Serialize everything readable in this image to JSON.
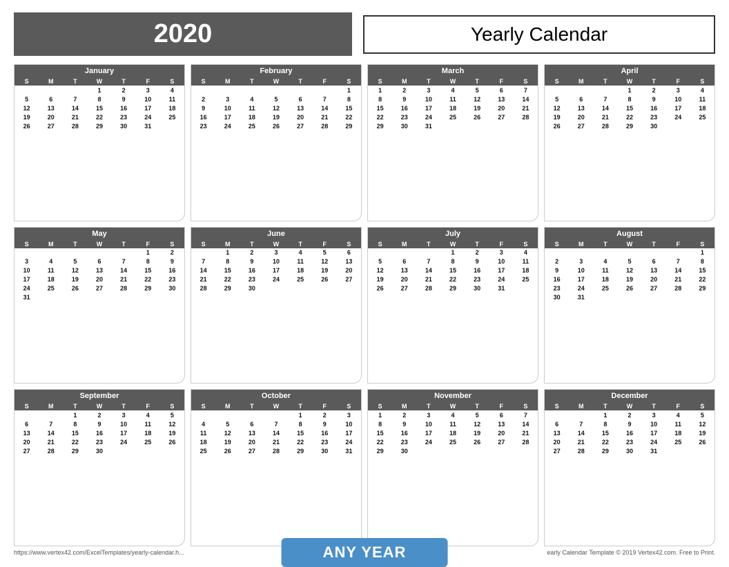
{
  "header": {
    "year": "2020",
    "title": "Yearly Calendar"
  },
  "footer": {
    "left": "https://www.vertex42.com/ExcelTemplates/yearly-calendar.h...",
    "right": "early Calendar Template © 2019 Vertex42.com. Free to Print.",
    "button": "ANY YEAR"
  },
  "months": [
    {
      "name": "January",
      "startDay": 3,
      "days": 31
    },
    {
      "name": "February",
      "startDay": 6,
      "days": 29
    },
    {
      "name": "March",
      "startDay": 0,
      "days": 31
    },
    {
      "name": "April",
      "startDay": 3,
      "days": 30
    },
    {
      "name": "May",
      "startDay": 5,
      "days": 31
    },
    {
      "name": "June",
      "startDay": 1,
      "days": 30
    },
    {
      "name": "July",
      "startDay": 3,
      "days": 31
    },
    {
      "name": "August",
      "startDay": 6,
      "days": 31
    },
    {
      "name": "September",
      "startDay": 2,
      "days": 30
    },
    {
      "name": "October",
      "startDay": 4,
      "days": 31
    },
    {
      "name": "November",
      "startDay": 0,
      "days": 30
    },
    {
      "name": "December",
      "startDay": 2,
      "days": 31
    }
  ],
  "dayHeaders": [
    "S",
    "M",
    "T",
    "W",
    "T",
    "F",
    "S"
  ]
}
